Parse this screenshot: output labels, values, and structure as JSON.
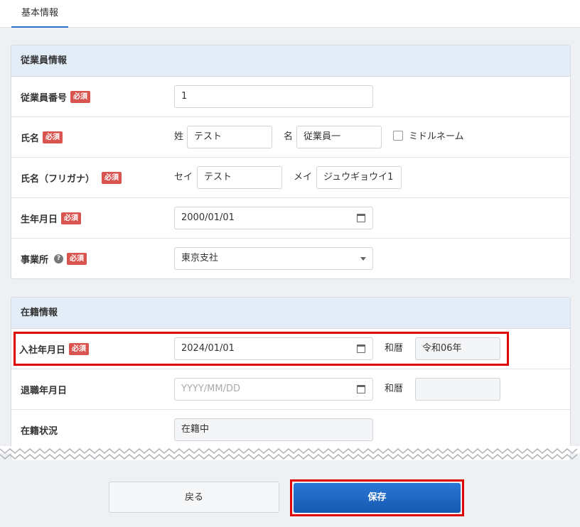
{
  "tabs": [
    {
      "label": "基本情報"
    }
  ],
  "sections": {
    "employee": {
      "title": "従業員情報",
      "required_label": "必須",
      "help_icon_glyph": "?",
      "employee_number": {
        "label": "従業員番号",
        "value": "1"
      },
      "name": {
        "label": "氏名",
        "last_label": "姓",
        "last_value": "テスト",
        "first_label": "名",
        "first_value": "従業員一",
        "middle_checkbox_label": "ミドルネーム",
        "middle_checked": false
      },
      "name_kana": {
        "label": "氏名（フリガナ）",
        "last_label": "セイ",
        "last_value": "テスト",
        "first_label": "メイ",
        "first_value": "ジュウギョウイ1"
      },
      "birth_date": {
        "label": "生年月日",
        "value": "2000/01/01"
      },
      "office": {
        "label": "事業所",
        "value": "東京支社"
      }
    },
    "enrollment": {
      "title": "在籍情報",
      "join_date": {
        "label": "入社年月日",
        "value": "2024/01/01",
        "era_label": "和暦",
        "era_value": "令和06年"
      },
      "leave_date": {
        "label": "退職年月日",
        "placeholder": "YYYY/MM/DD",
        "era_label": "和暦",
        "era_value": ""
      },
      "status": {
        "label": "在籍状況",
        "value": "在籍中"
      }
    }
  },
  "buttons": {
    "back": "戻る",
    "save": "保存"
  },
  "colors": {
    "accent": "#2a6fc9",
    "required": "#d9534f",
    "highlight": "#e00000",
    "save_button": "#1a63c0"
  }
}
